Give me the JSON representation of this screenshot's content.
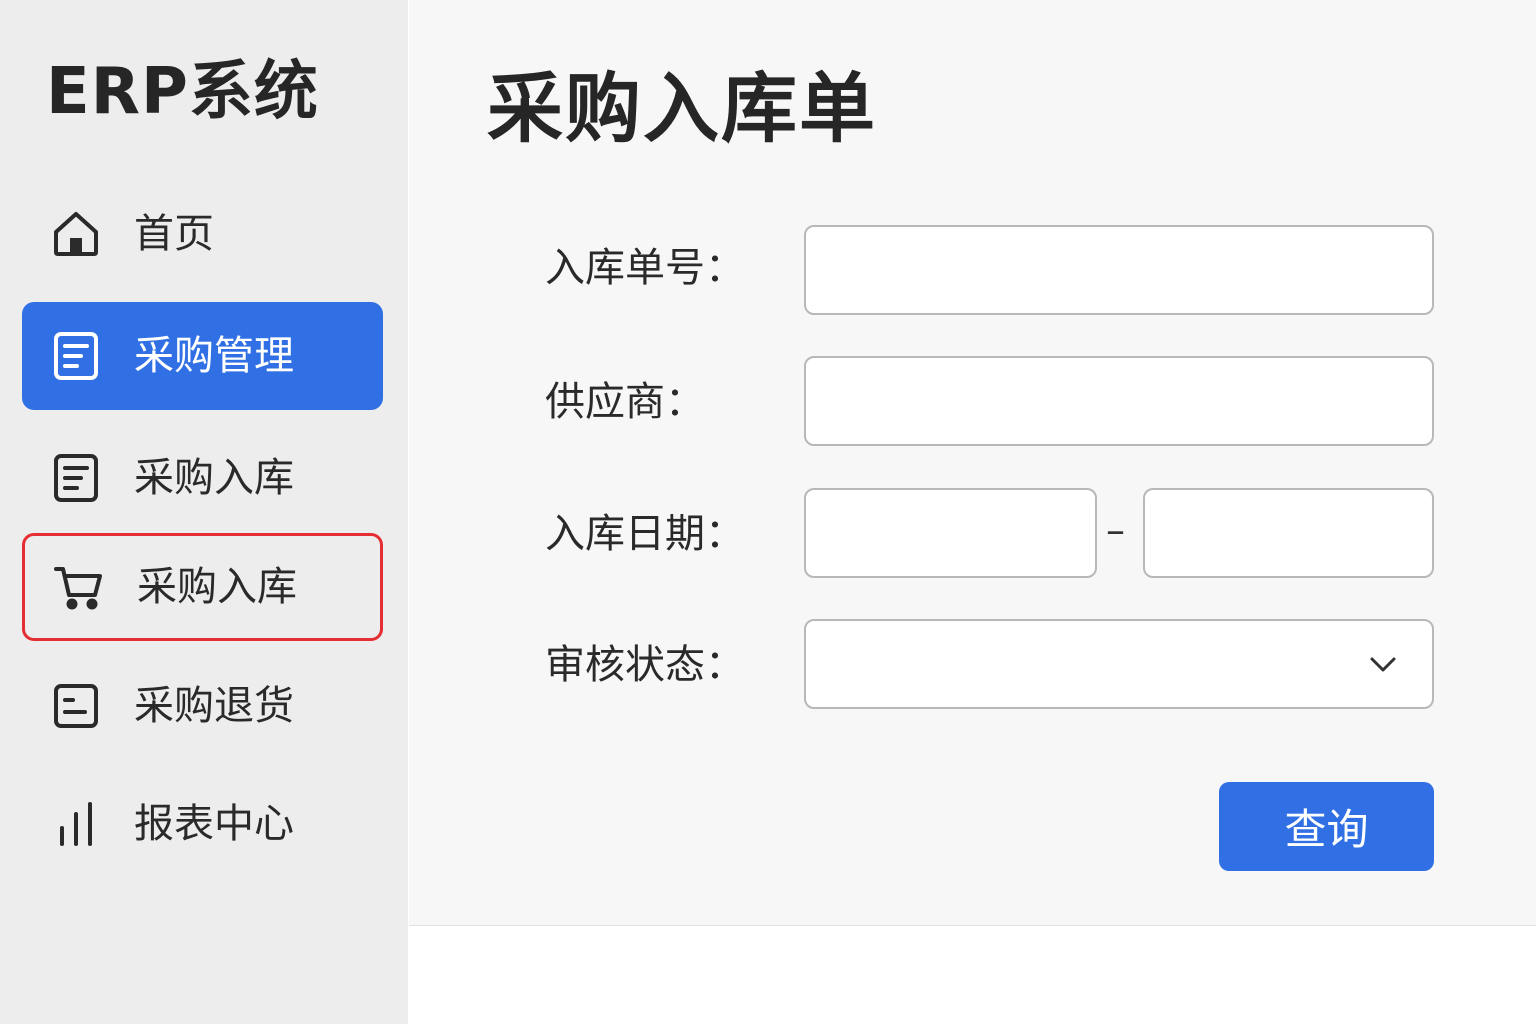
{
  "app": {
    "brand": "ERP系统"
  },
  "sidebar": {
    "items": [
      {
        "label": "首页",
        "icon": "home-icon"
      },
      {
        "label": "采购管理",
        "icon": "document-icon",
        "state": "active"
      },
      {
        "label": "采购入库",
        "icon": "document-icon"
      },
      {
        "label": "采购入库",
        "icon": "shopping-cart-icon",
        "state": "highlighted"
      },
      {
        "label": "采购退货",
        "icon": "return-icon"
      },
      {
        "label": "报表中心",
        "icon": "bar-chart-icon"
      }
    ]
  },
  "main": {
    "title": "采购入库单",
    "form": {
      "order_no": {
        "label": "入库单号：",
        "value": ""
      },
      "supplier": {
        "label": "供应商：",
        "value": ""
      },
      "date": {
        "label": "入库日期：",
        "start": "",
        "end": "",
        "separator": "–"
      },
      "status": {
        "label": "审核状态：",
        "value": ""
      }
    },
    "query_button": "查询"
  },
  "colors": {
    "accent": "#3170e4",
    "highlight_border": "#e52e33",
    "sidebar_bg": "#ededed",
    "main_bg": "#f7f7f7"
  }
}
